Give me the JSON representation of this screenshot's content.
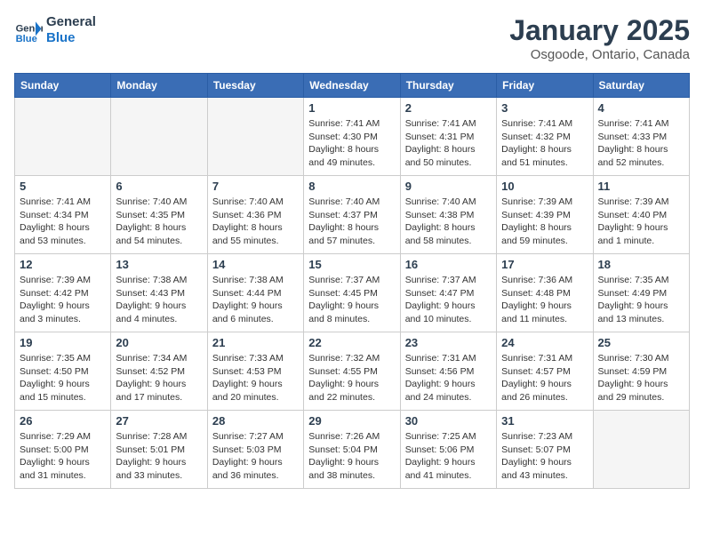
{
  "logo": {
    "text_general": "General",
    "text_blue": "Blue"
  },
  "header": {
    "title": "January 2025",
    "location": "Osgoode, Ontario, Canada"
  },
  "weekdays": [
    "Sunday",
    "Monday",
    "Tuesday",
    "Wednesday",
    "Thursday",
    "Friday",
    "Saturday"
  ],
  "weeks": [
    [
      {
        "day": "",
        "info": ""
      },
      {
        "day": "",
        "info": ""
      },
      {
        "day": "",
        "info": ""
      },
      {
        "day": "1",
        "info": "Sunrise: 7:41 AM\nSunset: 4:30 PM\nDaylight: 8 hours\nand 49 minutes."
      },
      {
        "day": "2",
        "info": "Sunrise: 7:41 AM\nSunset: 4:31 PM\nDaylight: 8 hours\nand 50 minutes."
      },
      {
        "day": "3",
        "info": "Sunrise: 7:41 AM\nSunset: 4:32 PM\nDaylight: 8 hours\nand 51 minutes."
      },
      {
        "day": "4",
        "info": "Sunrise: 7:41 AM\nSunset: 4:33 PM\nDaylight: 8 hours\nand 52 minutes."
      }
    ],
    [
      {
        "day": "5",
        "info": "Sunrise: 7:41 AM\nSunset: 4:34 PM\nDaylight: 8 hours\nand 53 minutes."
      },
      {
        "day": "6",
        "info": "Sunrise: 7:40 AM\nSunset: 4:35 PM\nDaylight: 8 hours\nand 54 minutes."
      },
      {
        "day": "7",
        "info": "Sunrise: 7:40 AM\nSunset: 4:36 PM\nDaylight: 8 hours\nand 55 minutes."
      },
      {
        "day": "8",
        "info": "Sunrise: 7:40 AM\nSunset: 4:37 PM\nDaylight: 8 hours\nand 57 minutes."
      },
      {
        "day": "9",
        "info": "Sunrise: 7:40 AM\nSunset: 4:38 PM\nDaylight: 8 hours\nand 58 minutes."
      },
      {
        "day": "10",
        "info": "Sunrise: 7:39 AM\nSunset: 4:39 PM\nDaylight: 8 hours\nand 59 minutes."
      },
      {
        "day": "11",
        "info": "Sunrise: 7:39 AM\nSunset: 4:40 PM\nDaylight: 9 hours\nand 1 minute."
      }
    ],
    [
      {
        "day": "12",
        "info": "Sunrise: 7:39 AM\nSunset: 4:42 PM\nDaylight: 9 hours\nand 3 minutes."
      },
      {
        "day": "13",
        "info": "Sunrise: 7:38 AM\nSunset: 4:43 PM\nDaylight: 9 hours\nand 4 minutes."
      },
      {
        "day": "14",
        "info": "Sunrise: 7:38 AM\nSunset: 4:44 PM\nDaylight: 9 hours\nand 6 minutes."
      },
      {
        "day": "15",
        "info": "Sunrise: 7:37 AM\nSunset: 4:45 PM\nDaylight: 9 hours\nand 8 minutes."
      },
      {
        "day": "16",
        "info": "Sunrise: 7:37 AM\nSunset: 4:47 PM\nDaylight: 9 hours\nand 10 minutes."
      },
      {
        "day": "17",
        "info": "Sunrise: 7:36 AM\nSunset: 4:48 PM\nDaylight: 9 hours\nand 11 minutes."
      },
      {
        "day": "18",
        "info": "Sunrise: 7:35 AM\nSunset: 4:49 PM\nDaylight: 9 hours\nand 13 minutes."
      }
    ],
    [
      {
        "day": "19",
        "info": "Sunrise: 7:35 AM\nSunset: 4:50 PM\nDaylight: 9 hours\nand 15 minutes."
      },
      {
        "day": "20",
        "info": "Sunrise: 7:34 AM\nSunset: 4:52 PM\nDaylight: 9 hours\nand 17 minutes."
      },
      {
        "day": "21",
        "info": "Sunrise: 7:33 AM\nSunset: 4:53 PM\nDaylight: 9 hours\nand 20 minutes."
      },
      {
        "day": "22",
        "info": "Sunrise: 7:32 AM\nSunset: 4:55 PM\nDaylight: 9 hours\nand 22 minutes."
      },
      {
        "day": "23",
        "info": "Sunrise: 7:31 AM\nSunset: 4:56 PM\nDaylight: 9 hours\nand 24 minutes."
      },
      {
        "day": "24",
        "info": "Sunrise: 7:31 AM\nSunset: 4:57 PM\nDaylight: 9 hours\nand 26 minutes."
      },
      {
        "day": "25",
        "info": "Sunrise: 7:30 AM\nSunset: 4:59 PM\nDaylight: 9 hours\nand 29 minutes."
      }
    ],
    [
      {
        "day": "26",
        "info": "Sunrise: 7:29 AM\nSunset: 5:00 PM\nDaylight: 9 hours\nand 31 minutes."
      },
      {
        "day": "27",
        "info": "Sunrise: 7:28 AM\nSunset: 5:01 PM\nDaylight: 9 hours\nand 33 minutes."
      },
      {
        "day": "28",
        "info": "Sunrise: 7:27 AM\nSunset: 5:03 PM\nDaylight: 9 hours\nand 36 minutes."
      },
      {
        "day": "29",
        "info": "Sunrise: 7:26 AM\nSunset: 5:04 PM\nDaylight: 9 hours\nand 38 minutes."
      },
      {
        "day": "30",
        "info": "Sunrise: 7:25 AM\nSunset: 5:06 PM\nDaylight: 9 hours\nand 41 minutes."
      },
      {
        "day": "31",
        "info": "Sunrise: 7:23 AM\nSunset: 5:07 PM\nDaylight: 9 hours\nand 43 minutes."
      },
      {
        "day": "",
        "info": ""
      }
    ]
  ]
}
